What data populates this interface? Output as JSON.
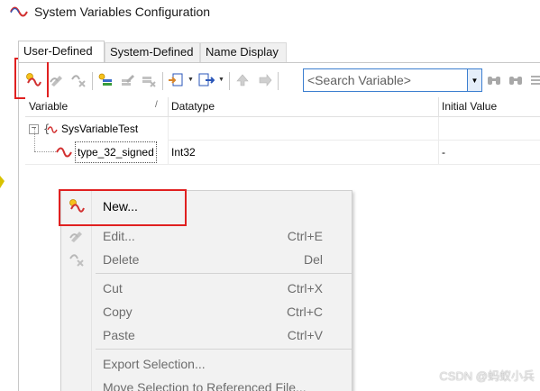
{
  "window": {
    "title": "System Variables Configuration"
  },
  "tabs": [
    {
      "label": "User-Defined",
      "active": true
    },
    {
      "label": "System-Defined",
      "active": false
    },
    {
      "label": "Name Display",
      "active": false
    }
  ],
  "toolbar": {
    "search": {
      "placeholder": "<Search Variable>"
    },
    "buttons": [
      {
        "icon": "new-variable-icon",
        "enabled": true
      },
      {
        "icon": "edit-variable-icon",
        "enabled": false
      },
      {
        "icon": "delete-variable-icon",
        "enabled": false
      },
      {
        "icon": "new-namespace-icon",
        "enabled": true
      },
      {
        "icon": "edit-namespace-icon",
        "enabled": false
      },
      {
        "icon": "delete-namespace-icon",
        "enabled": false
      },
      {
        "icon": "import-icon",
        "enabled": true
      },
      {
        "icon": "export-icon",
        "enabled": true
      },
      {
        "icon": "move-up-icon",
        "enabled": false
      },
      {
        "icon": "move-down-icon",
        "enabled": false
      },
      {
        "icon": "find-icon",
        "enabled": false
      },
      {
        "icon": "find-next-icon",
        "enabled": false
      },
      {
        "icon": "options-icon",
        "enabled": false
      }
    ]
  },
  "grid": {
    "columns": [
      "Variable",
      "Datatype",
      "Initial Value"
    ],
    "sort_indicator": "/",
    "rows": [
      {
        "kind": "namespace",
        "expander": "−",
        "name": "SysVariableTest",
        "datatype": "",
        "initial_value": ""
      },
      {
        "kind": "variable",
        "name": "type_32_signed",
        "datatype": "Int32",
        "initial_value": "-"
      }
    ]
  },
  "context_menu": {
    "items": [
      {
        "label": "New...",
        "shortcut": "",
        "enabled": true,
        "icon": "new-variable-icon"
      },
      {
        "label": "Edit...",
        "shortcut": "Ctrl+E",
        "enabled": false,
        "icon": "edit-variable-icon"
      },
      {
        "label": "Delete",
        "shortcut": "Del",
        "enabled": false,
        "icon": "delete-variable-icon"
      },
      {
        "label": "Cut",
        "shortcut": "Ctrl+X",
        "enabled": false
      },
      {
        "label": "Copy",
        "shortcut": "Ctrl+C",
        "enabled": false
      },
      {
        "label": "Paste",
        "shortcut": "Ctrl+V",
        "enabled": false
      },
      {
        "label": "Export Selection...",
        "shortcut": "",
        "enabled": false
      },
      {
        "label": "Move Selection to Referenced File...",
        "shortcut": "",
        "enabled": false
      }
    ]
  },
  "watermark": "CSDN @蚂蚁小兵",
  "colors": {
    "highlight": "#e02020",
    "accent": "#3c7fd0"
  }
}
